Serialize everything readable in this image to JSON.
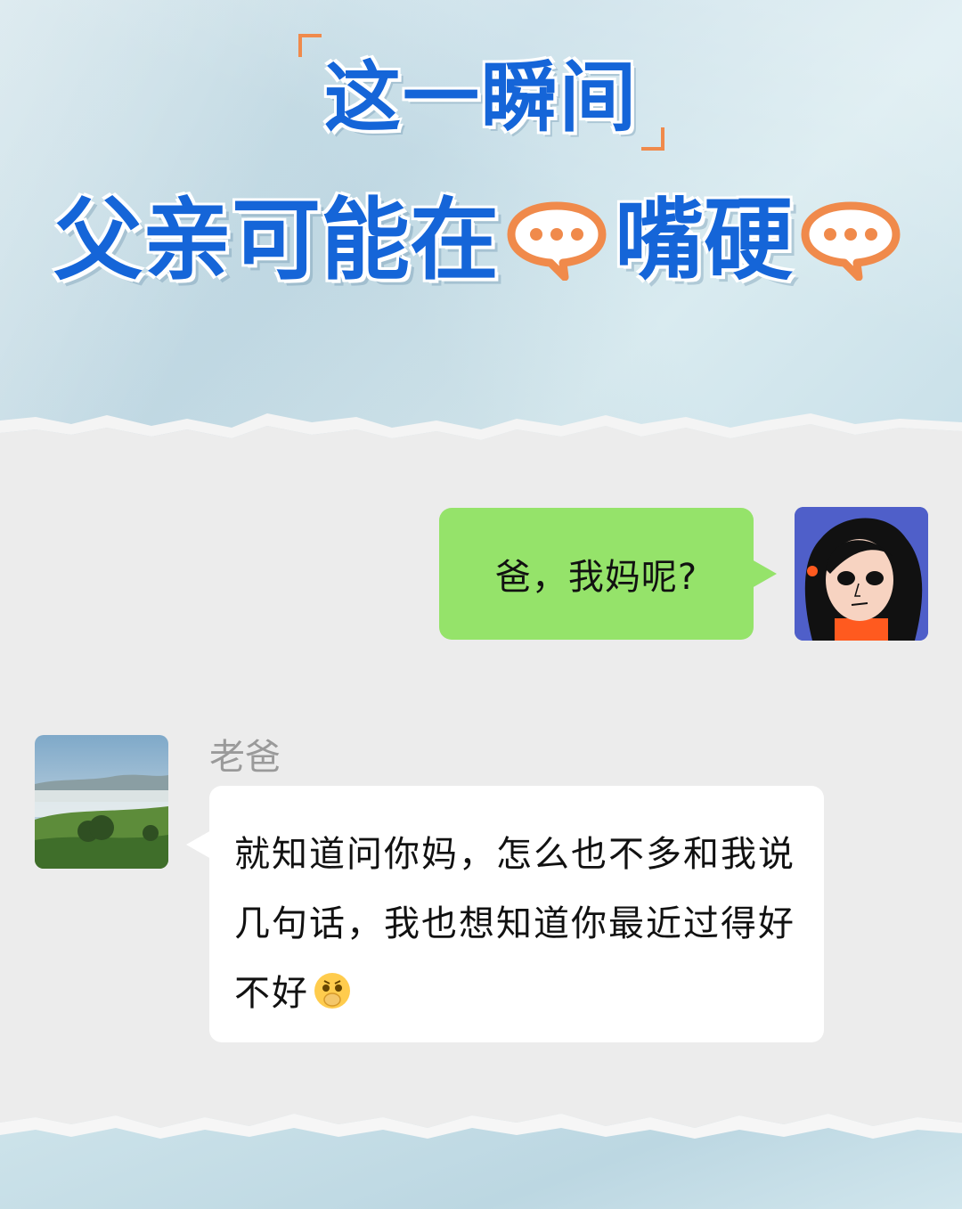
{
  "header": {
    "line1": "这一瞬间",
    "line2_part1": "父亲可能在",
    "line2_part2": "嘴硬"
  },
  "chat": {
    "outgoing_message": "爸，我妈呢?",
    "sender_name": "老爸",
    "incoming_message": "就知道问你妈，怎么也不多和我说几句话，我也想知道你最近过得好不好"
  },
  "icons": [
    "speech-bubble-icon",
    "avatar-girl",
    "avatar-landscape",
    "emoji-pleading-icon"
  ],
  "colors": {
    "title_blue": "#1565d8",
    "accent_orange": "#f08a4b",
    "bubble_green": "#95e36a",
    "bubble_white": "#ffffff",
    "chat_bg": "#ececec",
    "paper_blue": "#cfe3ea"
  }
}
